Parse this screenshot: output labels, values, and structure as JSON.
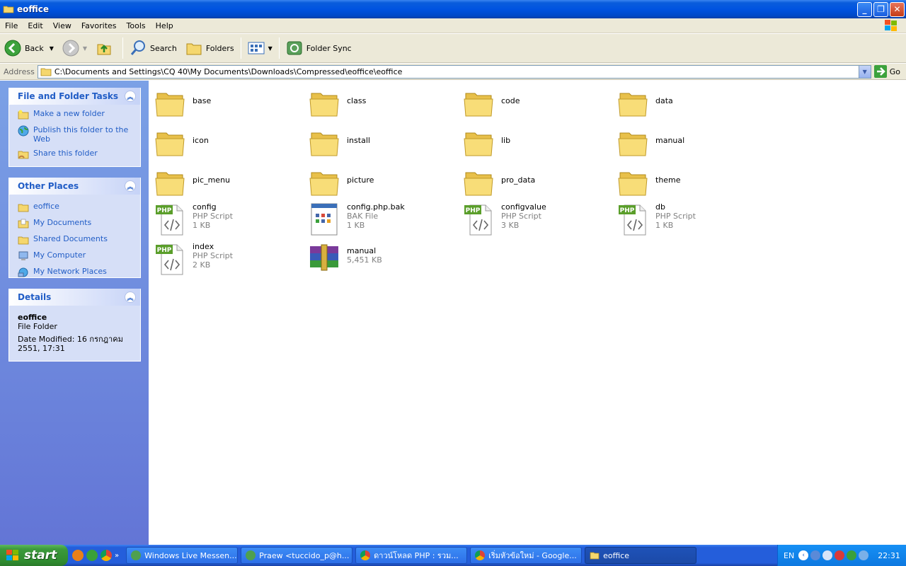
{
  "window": {
    "title": "eoffice"
  },
  "menu": [
    "File",
    "Edit",
    "View",
    "Favorites",
    "Tools",
    "Help"
  ],
  "toolbar": {
    "back": "Back",
    "search": "Search",
    "folders": "Folders",
    "folder_sync": "Folder Sync"
  },
  "address": {
    "label": "Address",
    "path": "C:\\Documents and Settings\\CQ 40\\My Documents\\Downloads\\Compressed\\eoffice\\eoffice",
    "go": "Go"
  },
  "tasks": {
    "title": "File and Folder Tasks",
    "items": [
      "Make a new folder",
      "Publish this folder to the Web",
      "Share this folder"
    ]
  },
  "places": {
    "title": "Other Places",
    "items": [
      "eoffice",
      "My Documents",
      "Shared Documents",
      "My Computer",
      "My Network Places"
    ]
  },
  "details": {
    "title": "Details",
    "name": "eoffice",
    "type": "File Folder",
    "modified": "Date Modified: 16 กรกฎาคม 2551, 17:31"
  },
  "files": [
    {
      "name": "base",
      "kind": "folder"
    },
    {
      "name": "class",
      "kind": "folder"
    },
    {
      "name": "code",
      "kind": "folder"
    },
    {
      "name": "data",
      "kind": "folder"
    },
    {
      "name": "icon",
      "kind": "folder"
    },
    {
      "name": "install",
      "kind": "folder"
    },
    {
      "name": "lib",
      "kind": "folder"
    },
    {
      "name": "manual",
      "kind": "folder"
    },
    {
      "name": "pic_menu",
      "kind": "folder"
    },
    {
      "name": "picture",
      "kind": "folder"
    },
    {
      "name": "pro_data",
      "kind": "folder"
    },
    {
      "name": "theme",
      "kind": "folder"
    },
    {
      "name": "config",
      "kind": "php",
      "type": "PHP Script",
      "size": "1 KB"
    },
    {
      "name": "config.php.bak",
      "kind": "bak",
      "type": "BAK File",
      "size": "1 KB"
    },
    {
      "name": "configvalue",
      "kind": "php",
      "type": "PHP Script",
      "size": "3 KB"
    },
    {
      "name": "db",
      "kind": "php",
      "type": "PHP Script",
      "size": "1 KB"
    },
    {
      "name": "index",
      "kind": "php",
      "type": "PHP Script",
      "size": "2 KB"
    },
    {
      "name": "manual",
      "kind": "rar",
      "type": "",
      "size": "5,451 KB"
    }
  ],
  "taskbar": {
    "start": "start",
    "buttons": [
      "Windows Live Messen...",
      "Praew <tuccido_p@h...",
      "ดาวน์โหลด PHP : รวม...",
      "เริ่มหัวข้อใหม่ - Google...",
      "eoffice"
    ],
    "lang": "EN",
    "clock": "22:31"
  },
  "colors": {
    "title_bar": "#0053e0",
    "task_pane": "#6375d6",
    "link": "#215dc6",
    "start": "#3c9a3c"
  }
}
